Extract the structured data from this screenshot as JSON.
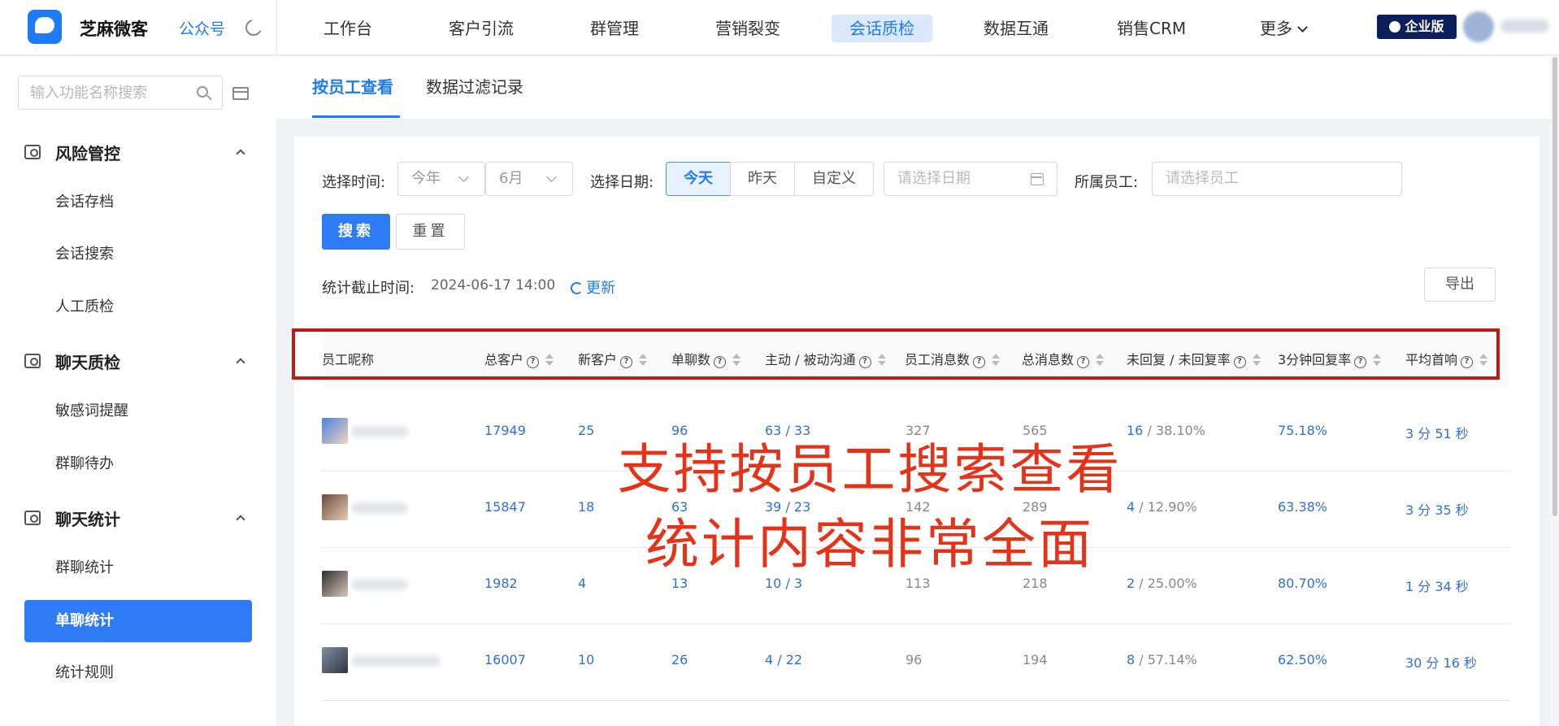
{
  "topbar": {
    "brand": "芝麻微客",
    "gzh_link": "公众号",
    "nav": [
      "工作台",
      "客户引流",
      "群管理",
      "营销裂变",
      "会话质检",
      "数据互通",
      "销售CRM",
      "更多"
    ],
    "active_nav": "会话质检",
    "enterprise_badge": "企业版"
  },
  "sidebar": {
    "search_placeholder": "输入功能名称搜索",
    "groups": [
      {
        "title": "风险管控",
        "items": [
          "会话存档",
          "会话搜索",
          "人工质检"
        ]
      },
      {
        "title": "聊天质检",
        "items": [
          "敏感词提醒",
          "群聊待办"
        ]
      },
      {
        "title": "聊天统计",
        "items": [
          "群聊统计",
          "单聊统计",
          "统计规则"
        ]
      }
    ],
    "active_item": "单聊统计"
  },
  "tabs": [
    "按员工查看",
    "数据过滤记录"
  ],
  "filters": {
    "time_label": "选择时间:",
    "year_value": "今年",
    "month_value": "6月",
    "date_label": "选择日期:",
    "date_options": [
      "今天",
      "昨天",
      "自定义"
    ],
    "date_active": "今天",
    "date_placeholder": "请选择日期",
    "staff_label": "所属员工:",
    "staff_placeholder": "请选择员工",
    "search_btn": "搜索",
    "reset_btn": "重置"
  },
  "stats": {
    "cutoff_label": "统计截止时间:",
    "cutoff_time": "2024-06-17 14:00",
    "refresh": "更新",
    "export": "导出"
  },
  "table": {
    "columns": [
      "员工昵称",
      "总客户",
      "新客户",
      "单聊数",
      "主动 / 被动沟通",
      "员工消息数",
      "总消息数",
      "未回复 / 未回复率",
      "3分钟回复率",
      "平均首响"
    ],
    "rows": [
      {
        "total": "17949",
        "new": "25",
        "chats": "96",
        "comm": "63 / 33",
        "staff_msgs": "327",
        "total_msgs": "565",
        "unreplied": "16",
        "unreplied_rate": " / 38.10%",
        "rate3": "75.18%",
        "first": "3 分 51 秒"
      },
      {
        "total": "15847",
        "new": "18",
        "chats": "63",
        "comm": "39 / 23",
        "staff_msgs": "142",
        "total_msgs": "289",
        "unreplied": "4",
        "unreplied_rate": " / 12.90%",
        "rate3": "63.38%",
        "first": "3 分 35 秒"
      },
      {
        "total": "1982",
        "new": "4",
        "chats": "13",
        "comm": "10 / 3",
        "staff_msgs": "113",
        "total_msgs": "218",
        "unreplied": "2",
        "unreplied_rate": " / 25.00%",
        "rate3": "80.70%",
        "first": "1 分 34 秒"
      },
      {
        "total": "16007",
        "new": "10",
        "chats": "26",
        "comm": "4 / 22",
        "staff_msgs": "96",
        "total_msgs": "194",
        "unreplied": "8",
        "unreplied_rate": " / 57.14%",
        "rate3": "62.50%",
        "first": "30 分 16 秒"
      }
    ]
  },
  "overlay": {
    "line1": "支持按员工搜索查看",
    "line2": "统计内容非常全面"
  },
  "colors": {
    "primary": "#1e7bf7",
    "overlay_red": "#e5331a",
    "frame_red": "#c01a14"
  }
}
